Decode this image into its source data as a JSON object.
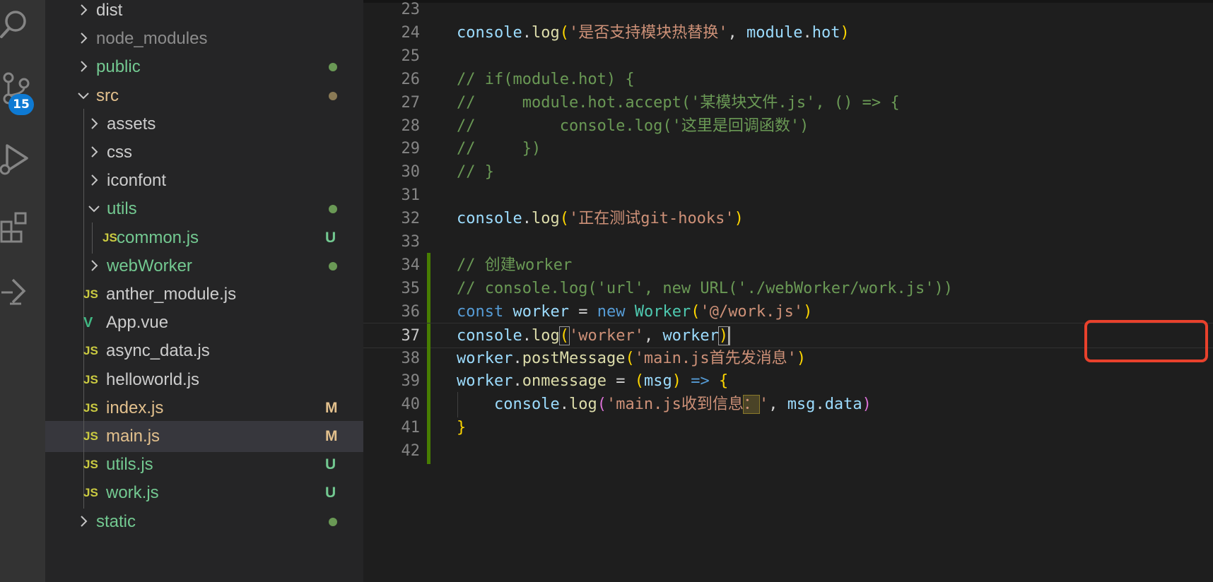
{
  "activity_bar": {
    "icons": [
      "search-icon",
      "source-control-icon",
      "run-debug-icon",
      "extensions-icon",
      "remote-icon"
    ],
    "scm_badge": "15"
  },
  "explorer": {
    "rows": [
      {
        "label": "dist",
        "kind": "folder",
        "expanded": false,
        "color": "#cccccc"
      },
      {
        "label": "node_modules",
        "kind": "folder",
        "expanded": false,
        "color": "#8c8c8c"
      },
      {
        "label": "public",
        "kind": "folder",
        "expanded": false,
        "color": "#73c991",
        "dot": "#6a9955"
      },
      {
        "label": "src",
        "kind": "folder",
        "expanded": true,
        "color": "#e2c08d",
        "dot": "#8a7a55"
      },
      {
        "label": "assets",
        "kind": "folder",
        "expanded": false,
        "color": "#cccccc"
      },
      {
        "label": "css",
        "kind": "folder",
        "expanded": false,
        "color": "#cccccc"
      },
      {
        "label": "iconfont",
        "kind": "folder",
        "expanded": false,
        "color": "#cccccc"
      },
      {
        "label": "utils",
        "kind": "folder",
        "expanded": true,
        "color": "#73c991",
        "dot": "#6a9955"
      },
      {
        "label": "common.js",
        "kind": "file",
        "icon": "JS",
        "color": "#73c991",
        "status": "U",
        "status_color": "#73c991"
      },
      {
        "label": "webWorker",
        "kind": "folder",
        "expanded": false,
        "color": "#73c991",
        "dot": "#6a9955"
      },
      {
        "label": "anther_module.js",
        "kind": "file",
        "icon": "JS",
        "color": "#cccccc"
      },
      {
        "label": "App.vue",
        "kind": "file",
        "icon": "V",
        "color": "#cccccc"
      },
      {
        "label": "async_data.js",
        "kind": "file",
        "icon": "JS",
        "color": "#cccccc"
      },
      {
        "label": "helloworld.js",
        "kind": "file",
        "icon": "JS",
        "color": "#cccccc"
      },
      {
        "label": "index.js",
        "kind": "file",
        "icon": "JS",
        "color": "#e2c08d",
        "status": "M",
        "status_color": "#e2c08d"
      },
      {
        "label": "main.js",
        "kind": "file",
        "icon": "JS",
        "color": "#e2c08d",
        "status": "M",
        "status_color": "#e2c08d",
        "selected": true
      },
      {
        "label": "utils.js",
        "kind": "file",
        "icon": "JS",
        "color": "#73c991",
        "status": "U",
        "status_color": "#73c991"
      },
      {
        "label": "work.js",
        "kind": "file",
        "icon": "JS",
        "color": "#73c991",
        "status": "U",
        "status_color": "#73c991"
      },
      {
        "label": "static",
        "kind": "folder",
        "expanded": false,
        "color": "#73c991",
        "dot": "#6a9955"
      }
    ]
  },
  "editor": {
    "active_line": 37,
    "lines": [
      {
        "n": 23,
        "tokens": []
      },
      {
        "n": 24,
        "tokens": [
          [
            "var",
            "console"
          ],
          [
            "pun",
            "."
          ],
          [
            "fn",
            "log"
          ],
          [
            "br1",
            "("
          ],
          [
            "str",
            "'是否支持模块热替换'"
          ],
          [
            "pun",
            ", "
          ],
          [
            "var",
            "module"
          ],
          [
            "pun",
            "."
          ],
          [
            "var",
            "hot"
          ],
          [
            "br1",
            ")"
          ]
        ]
      },
      {
        "n": 25,
        "tokens": []
      },
      {
        "n": 26,
        "tokens": [
          [
            "cmt",
            "// if(module.hot) {"
          ]
        ]
      },
      {
        "n": 27,
        "tokens": [
          [
            "cmt",
            "//     module.hot.accept('某模块文件.js', () => {"
          ]
        ]
      },
      {
        "n": 28,
        "tokens": [
          [
            "cmt",
            "//         console.log('这里是回调函数')"
          ]
        ]
      },
      {
        "n": 29,
        "tokens": [
          [
            "cmt",
            "//     })"
          ]
        ]
      },
      {
        "n": 30,
        "tokens": [
          [
            "cmt",
            "// }"
          ]
        ]
      },
      {
        "n": 31,
        "tokens": []
      },
      {
        "n": 32,
        "tokens": [
          [
            "var",
            "console"
          ],
          [
            "pun",
            "."
          ],
          [
            "fn",
            "log"
          ],
          [
            "br1",
            "("
          ],
          [
            "str",
            "'正在测试git-hooks'"
          ],
          [
            "br1",
            ")"
          ]
        ]
      },
      {
        "n": 33,
        "tokens": []
      },
      {
        "n": 34,
        "gutter": true,
        "tokens": [
          [
            "cmt",
            "// 创建worker"
          ]
        ]
      },
      {
        "n": 35,
        "gutter": true,
        "tokens": [
          [
            "cmt",
            "// console.log('url', new URL('./webWorker/work.js'))"
          ]
        ]
      },
      {
        "n": 36,
        "gutter": true,
        "tokens": [
          [
            "kw",
            "const"
          ],
          [
            "pun",
            " "
          ],
          [
            "var",
            "worker"
          ],
          [
            "pun",
            " = "
          ],
          [
            "kw",
            "new"
          ],
          [
            "pun",
            " "
          ],
          [
            "cls",
            "Worker"
          ],
          [
            "br1",
            "("
          ],
          [
            "str",
            "'@/work.js'"
          ],
          [
            "br1",
            ")"
          ]
        ]
      },
      {
        "n": 37,
        "gutter": true,
        "tokens": [
          [
            "var",
            "console"
          ],
          [
            "pun",
            "."
          ],
          [
            "fn",
            "log"
          ],
          [
            "br1bm",
            "("
          ],
          [
            "str",
            "'worker'"
          ],
          [
            "pun",
            ", "
          ],
          [
            "var",
            "worker"
          ],
          [
            "br1cur",
            ")"
          ]
        ]
      },
      {
        "n": 38,
        "gutter": true,
        "tokens": [
          [
            "var",
            "worker"
          ],
          [
            "pun",
            "."
          ],
          [
            "fn",
            "postMessage"
          ],
          [
            "br1",
            "("
          ],
          [
            "str",
            "'main.js首先发消息'"
          ],
          [
            "br1",
            ")"
          ]
        ]
      },
      {
        "n": 39,
        "gutter": true,
        "tokens": [
          [
            "var",
            "worker"
          ],
          [
            "pun",
            "."
          ],
          [
            "fn",
            "onmessage"
          ],
          [
            "pun",
            " = "
          ],
          [
            "br1",
            "("
          ],
          [
            "var",
            "msg"
          ],
          [
            "br1",
            ")"
          ],
          [
            "pun",
            " "
          ],
          [
            "kw",
            "=>"
          ],
          [
            "pun",
            " "
          ],
          [
            "br1",
            "{"
          ]
        ]
      },
      {
        "n": 40,
        "gutter": true,
        "indent": true,
        "tokens": [
          [
            "pun",
            "    "
          ],
          [
            "var",
            "console"
          ],
          [
            "pun",
            "."
          ],
          [
            "fn",
            "log"
          ],
          [
            "br2",
            "("
          ],
          [
            "str",
            "'main.js收到信息"
          ],
          [
            "strhl",
            "："
          ],
          [
            "str",
            "'"
          ],
          [
            "pun",
            ", "
          ],
          [
            "var",
            "msg"
          ],
          [
            "pun",
            "."
          ],
          [
            "var",
            "data"
          ],
          [
            "br2",
            ")"
          ]
        ]
      },
      {
        "n": 41,
        "gutter": true,
        "tokens": [
          [
            "br1",
            "}"
          ]
        ]
      },
      {
        "n": 42,
        "gutter": true,
        "tokens": []
      }
    ]
  }
}
